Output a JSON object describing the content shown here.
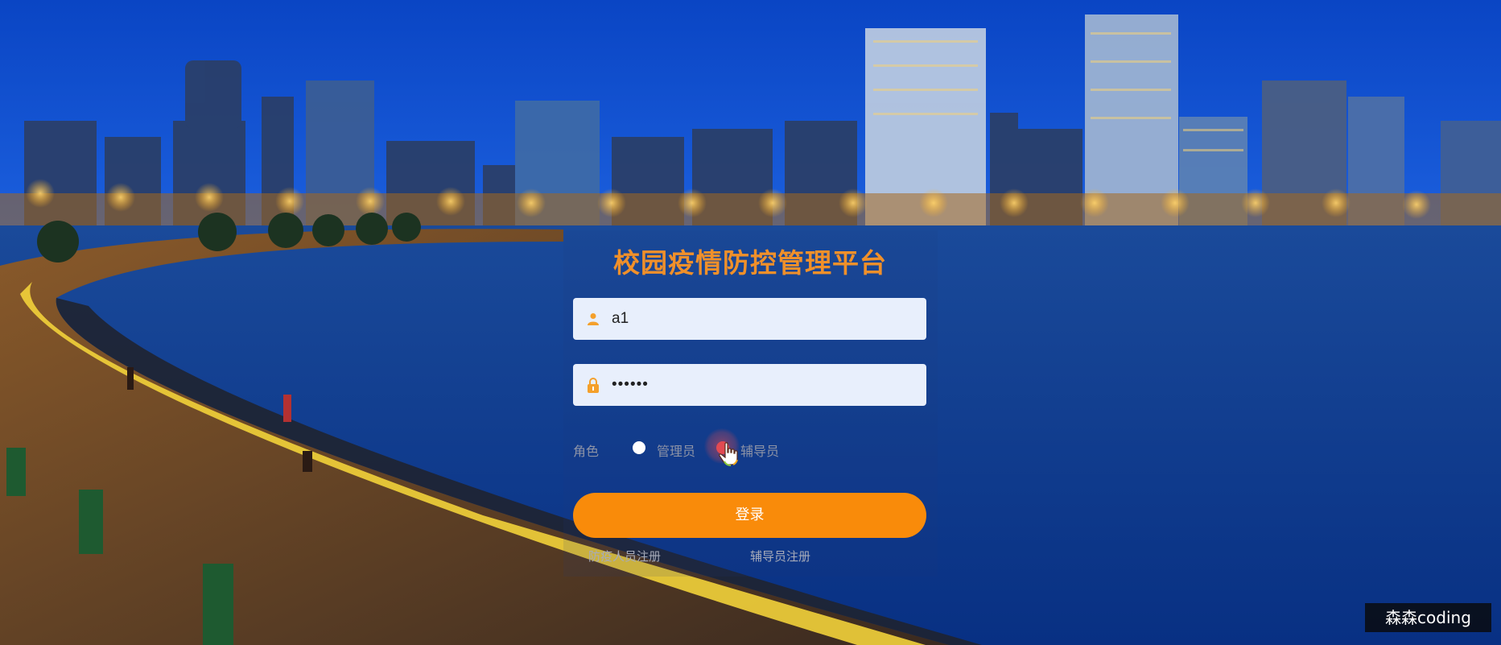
{
  "app": {
    "title": "校园疫情防控管理平台"
  },
  "login_form": {
    "username_value": "a1",
    "password_value": "••••••",
    "role_label": "角色",
    "roles": [
      {
        "label": "管理员",
        "selected": false
      },
      {
        "label": "辅导员",
        "selected": true
      }
    ],
    "submit_label": "登录"
  },
  "links": {
    "register_epidemic_staff": "防疫人员注册",
    "register_counselor": "辅导员注册"
  },
  "watermark": {
    "text": "森森coding"
  },
  "colors": {
    "accent": "#f98b0a",
    "title": "#f0902a",
    "input_bg": "#e8effc",
    "selected_radio": "#e24a52"
  },
  "icons": {
    "username": "user-icon",
    "password": "lock-icon",
    "cursor": "hand-pointer-icon"
  }
}
